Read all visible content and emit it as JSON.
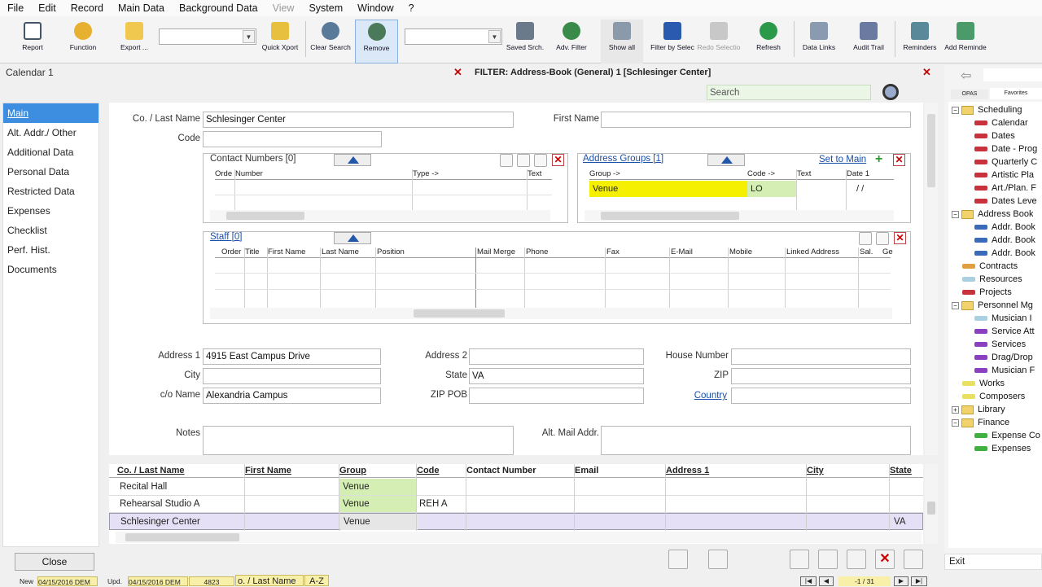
{
  "menu": {
    "items": [
      "File",
      "Edit",
      "Record",
      "Main Data",
      "Background Data",
      "View",
      "System",
      "Window",
      "?"
    ]
  },
  "toolbar": {
    "report": "Report",
    "function": "Function",
    "export": "Export ...",
    "quick_xport": "Quick Xport",
    "clear_search": "Clear Search",
    "remove": "Remove",
    "saved_search": "Saved Srch.",
    "adv_filter": "Adv. Filter",
    "show_all": "Show all",
    "filter_by_select": "Filter by Selec",
    "redo_selection": "Redo Selectio",
    "refresh": "Refresh",
    "data_links": "Data Links",
    "audit_trail": "Audit Trail",
    "reminders": "Reminders",
    "add_reminder": "Add Reminde"
  },
  "calendar_tab": "Calendar  1",
  "filter_tab": "FILTER: Address-Book (General)  1 [Schlesinger Center]",
  "search": {
    "placeholder": "Search"
  },
  "leftnav": [
    "Main",
    "Alt. Addr./ Other",
    "Additional Data",
    "Personal Data",
    "Restricted Data",
    "Expenses",
    "Checklist",
    "Perf. Hist.",
    "Documents"
  ],
  "form": {
    "co_last_name_label": "Co. / Last Name",
    "co_last_name": "Schlesinger Center",
    "first_name_label": "First Name",
    "first_name": "",
    "code_label": "Code",
    "code": "",
    "contact_numbers": {
      "title": "Contact Numbers  [0]",
      "cols": [
        "Orde",
        "Number",
        "Type ->",
        "Text"
      ]
    },
    "address_groups": {
      "title": "Address Groups  [1]",
      "set_to_main": "Set to Main",
      "cols": [
        "Group ->",
        "Code ->",
        "Text",
        "Date 1"
      ],
      "row": {
        "group": "Venue",
        "code": "LO",
        "text": "",
        "date": "/ /"
      }
    },
    "staff": {
      "title": "Staff  [0]",
      "cols": [
        "Order",
        "Title",
        "First Name",
        "Last Name",
        "Position",
        "Mail Merge",
        "Phone",
        "Fax",
        "E-Mail",
        "Mobile",
        "Linked Address",
        "Sal.",
        "Ge"
      ]
    },
    "address1_label": "Address 1",
    "address1": "4915 East Campus Drive",
    "address2_label": "Address 2",
    "address2": "",
    "house_number_label": "House Number",
    "house_number": "",
    "city_label": "City",
    "city": "",
    "state_label": "State",
    "state": "VA",
    "zip_label": "ZIP",
    "zip": "",
    "co_name_label": "c/o Name",
    "co_name": "Alexandria Campus",
    "zip_pob_label": "ZIP POB",
    "zip_pob": "",
    "country_label": "Country",
    "country": "",
    "notes_label": "Notes",
    "notes": "",
    "alt_mail_label": "Alt. Mail Addr.",
    "alt_mail": ""
  },
  "grid": {
    "cols": [
      "Co. / Last Name",
      "First Name",
      "Group",
      "Code",
      "Contact Number",
      "Email",
      "Address 1",
      "City",
      "State"
    ],
    "rows": [
      {
        "name": "Recital Hall",
        "first": "",
        "group": "Venue",
        "code": "",
        "state": ""
      },
      {
        "name": "Rehearsal Studio A",
        "first": "",
        "group": "Venue",
        "code": "REH A",
        "state": ""
      },
      {
        "name": "Schlesinger Center",
        "first": "",
        "group": "Venue",
        "code": "",
        "state": "VA"
      }
    ]
  },
  "right": {
    "tabs": [
      "OPAS",
      "Favorites"
    ],
    "exit": "Exit",
    "tree": [
      {
        "t": "Scheduling",
        "type": "folder",
        "lvl": 0,
        "pm": "−"
      },
      {
        "t": "Calendar",
        "type": "bar",
        "c": "#c8323c",
        "lvl": 1
      },
      {
        "t": "Dates",
        "type": "bar",
        "c": "#c8323c",
        "lvl": 1
      },
      {
        "t": "Date - Prog",
        "type": "bar",
        "c": "#c8323c",
        "lvl": 1
      },
      {
        "t": "Quarterly C",
        "type": "bar",
        "c": "#c8323c",
        "lvl": 1
      },
      {
        "t": "Artistic Pla",
        "type": "bar",
        "c": "#c8323c",
        "lvl": 1
      },
      {
        "t": "Art./Plan. F",
        "type": "bar",
        "c": "#c8323c",
        "lvl": 1
      },
      {
        "t": "Dates Leve",
        "type": "bar",
        "c": "#c8323c",
        "lvl": 1
      },
      {
        "t": "Address Book",
        "type": "folder",
        "lvl": 0,
        "pm": "−"
      },
      {
        "t": "Addr. Book",
        "type": "bar",
        "c": "#3a6ab8",
        "lvl": 1
      },
      {
        "t": "Addr. Book",
        "type": "bar",
        "c": "#3a6ab8",
        "lvl": 1
      },
      {
        "t": "Addr. Book",
        "type": "bar",
        "c": "#3a6ab8",
        "lvl": 1
      },
      {
        "t": "Contracts",
        "type": "bar",
        "c": "#e0a040",
        "lvl": 0
      },
      {
        "t": "Resources",
        "type": "bar",
        "c": "#a8d0e0",
        "lvl": 0
      },
      {
        "t": "Projects",
        "type": "bar",
        "c": "#c8323c",
        "lvl": 0
      },
      {
        "t": "Personnel Mg",
        "type": "folder",
        "lvl": 0,
        "pm": "−"
      },
      {
        "t": "Musician I",
        "type": "bar",
        "c": "#a8d0e0",
        "lvl": 1
      },
      {
        "t": "Service Att",
        "type": "bar",
        "c": "#8a40c0",
        "lvl": 1
      },
      {
        "t": "Services",
        "type": "bar",
        "c": "#8a40c0",
        "lvl": 1
      },
      {
        "t": "Drag/Drop",
        "type": "bar",
        "c": "#8a40c0",
        "lvl": 1
      },
      {
        "t": "Musician F",
        "type": "bar",
        "c": "#8a40c0",
        "lvl": 1
      },
      {
        "t": "Works",
        "type": "bar",
        "c": "#e8e060",
        "lvl": 0
      },
      {
        "t": "Composers",
        "type": "bar",
        "c": "#e8e060",
        "lvl": 0
      },
      {
        "t": "Library",
        "type": "folder",
        "lvl": 0,
        "pm": "+"
      },
      {
        "t": "Finance",
        "type": "folder",
        "lvl": 0,
        "pm": "−"
      },
      {
        "t": "Expense Co",
        "type": "bar",
        "c": "#40b040",
        "lvl": 1
      },
      {
        "t": "Expenses",
        "type": "bar",
        "c": "#40b040",
        "lvl": 1
      }
    ]
  },
  "bottom": {
    "close": "Close",
    "new_label": "New",
    "new_date": "04/15/2016 DEM",
    "upd_label": "Upd.",
    "upd_date": "04/15/2016 DEM",
    "record_id": "4823",
    "sort_field": "o. / Last Name",
    "sort_order": "A-Z",
    "nav_position": "-1 / 31"
  }
}
